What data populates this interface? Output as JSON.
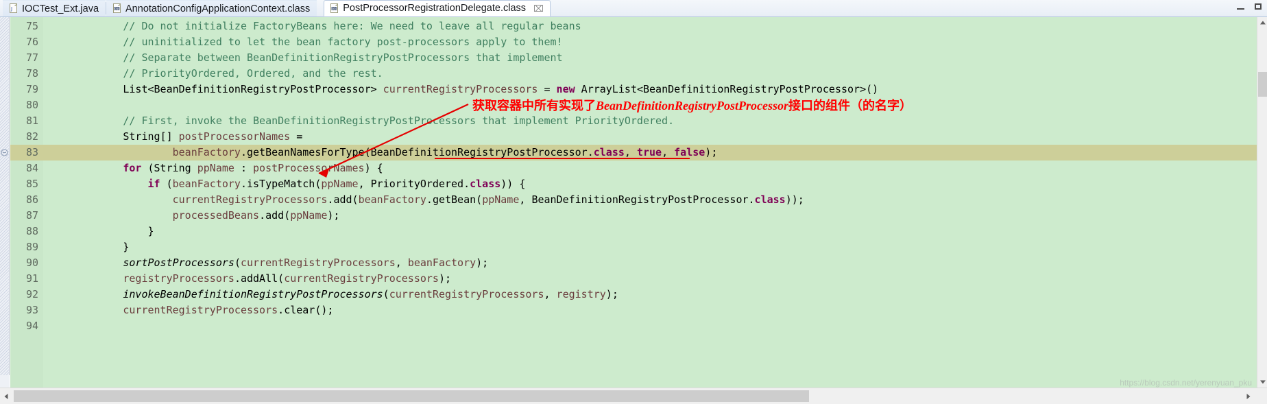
{
  "window": {
    "controls": {
      "minimize": "minimize",
      "maximize": "maximize"
    }
  },
  "tabs": [
    {
      "label": "IOCTest_Ext.java",
      "icon": "java-file-icon",
      "active": false,
      "closable": false
    },
    {
      "label": "AnnotationConfigApplicationContext.class",
      "icon": "class-file-icon",
      "active": false,
      "closable": false
    },
    {
      "label": "PostProcessorRegistrationDelegate.class",
      "icon": "class-file-icon",
      "active": true,
      "closable": true,
      "close_glyph": "⌧"
    }
  ],
  "editor": {
    "current_line": 83,
    "line_numbers": [
      75,
      76,
      77,
      78,
      79,
      80,
      81,
      82,
      83,
      84,
      85,
      86,
      87,
      88,
      89,
      90,
      91,
      92,
      93,
      94
    ],
    "lines": [
      {
        "n": 75,
        "text": "            // Do not initialize FactoryBeans here: We need to leave all regular beans"
      },
      {
        "n": 76,
        "text": "            // uninitialized to let the bean factory post-processors apply to them!"
      },
      {
        "n": 77,
        "text": "            // Separate between BeanDefinitionRegistryPostProcessors that implement"
      },
      {
        "n": 78,
        "text": "            // PriorityOrdered, Ordered, and the rest."
      },
      {
        "n": 79,
        "text": "            List<BeanDefinitionRegistryPostProcessor> currentRegistryProcessors = new ArrayList<BeanDefinitionRegistryPostProcessor>()"
      },
      {
        "n": 80,
        "text": ""
      },
      {
        "n": 81,
        "text": "            // First, invoke the BeanDefinitionRegistryPostProcessors that implement PriorityOrdered."
      },
      {
        "n": 82,
        "text": "            String[] postProcessorNames ="
      },
      {
        "n": 83,
        "text": "                    beanFactory.getBeanNamesForType(BeanDefinitionRegistryPostProcessor.class, true, false);"
      },
      {
        "n": 84,
        "text": "            for (String ppName : postProcessorNames) {"
      },
      {
        "n": 85,
        "text": "                if (beanFactory.isTypeMatch(ppName, PriorityOrdered.class)) {"
      },
      {
        "n": 86,
        "text": "                    currentRegistryProcessors.add(beanFactory.getBean(ppName, BeanDefinitionRegistryPostProcessor.class));"
      },
      {
        "n": 87,
        "text": "                    processedBeans.add(ppName);"
      },
      {
        "n": 88,
        "text": "                }"
      },
      {
        "n": 89,
        "text": "            }"
      },
      {
        "n": 90,
        "text": "            sortPostProcessors(currentRegistryProcessors, beanFactory);"
      },
      {
        "n": 91,
        "text": "            registryProcessors.addAll(currentRegistryProcessors);"
      },
      {
        "n": 92,
        "text": "            invokeBeanDefinitionRegistryPostProcessors(currentRegistryProcessors, registry);"
      },
      {
        "n": 93,
        "text": "            currentRegistryProcessors.clear();"
      },
      {
        "n": 94,
        "text": ""
      }
    ]
  },
  "annotation": {
    "text_cn_prefix": "获取容器中所有实现了",
    "text_en": "BeanDefinitionRegistryPostProcessor",
    "text_cn_suffix": "接口的组件（的名字）",
    "color": "#ff0000",
    "arrow": "red-arrow-pointing-to-line-83"
  },
  "watermark": {
    "text": "https://blog.csdn.net/yerenyuan_pku"
  },
  "colors": {
    "code_background": "#cdebcd",
    "gutter_background": "#c9e7c9",
    "current_line_highlight": "#cdcf99",
    "comment": "#3f7f5f",
    "keyword": "#7f0055",
    "field": "#0000c0",
    "local_variable": "#6a3d3d",
    "annotation_red": "#ff0000",
    "tab_active": "#ffffff"
  },
  "scrollbars": {
    "vertical": {
      "up": "▲",
      "down": "▼"
    },
    "horizontal": {
      "left": "◄",
      "right": "►"
    }
  }
}
